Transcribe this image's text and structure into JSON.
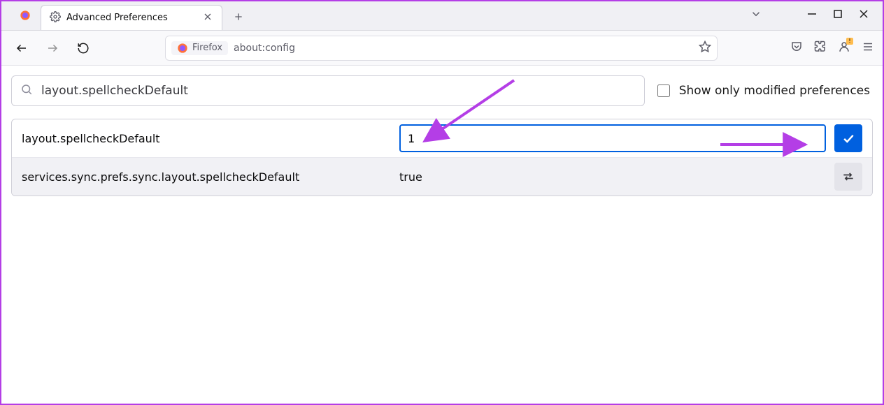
{
  "window": {
    "tab_title": "Advanced Preferences",
    "identity_label": "Firefox",
    "url": "about:config"
  },
  "config": {
    "search_value": "layout.spellcheckDefault",
    "show_only_modified_label": "Show only modified preferences",
    "rows": [
      {
        "name": "layout.spellcheckDefault",
        "edit_value": "1"
      },
      {
        "name": "services.sync.prefs.sync.layout.spellcheckDefault",
        "value": "true"
      }
    ]
  }
}
